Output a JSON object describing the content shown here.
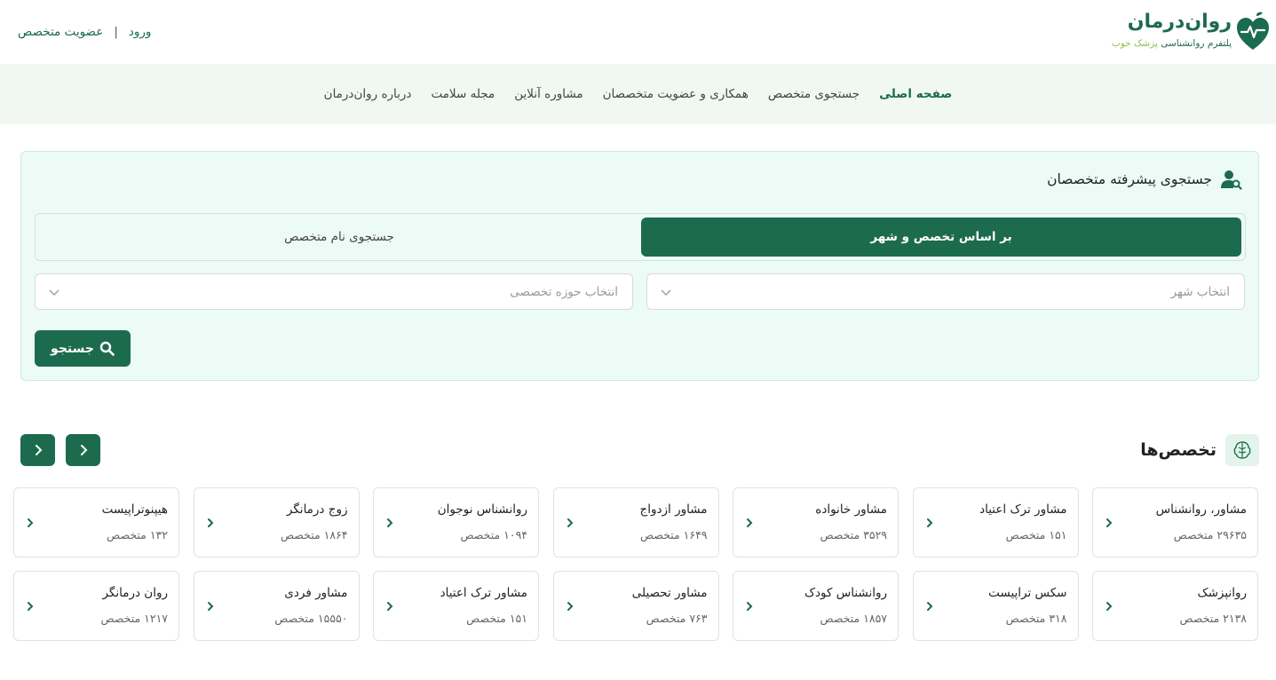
{
  "brand": {
    "title": "روان‌درمان",
    "subtitle_main": "پلتفرم روانشناسی ",
    "subtitle_accent": "پزشک خوب"
  },
  "auth": {
    "membership": "عضویت متخصص",
    "separator": "|",
    "login": "ورود"
  },
  "nav": [
    {
      "label": "صفحه اصلی",
      "active": true
    },
    {
      "label": "جستجوی متخصص",
      "active": false
    },
    {
      "label": "همکاری و عضویت متخصصان",
      "active": false
    },
    {
      "label": "مشاوره آنلاین",
      "active": false
    },
    {
      "label": "مجله سلامت",
      "active": false
    },
    {
      "label": "درباره روان‌درمان",
      "active": false
    }
  ],
  "search": {
    "title": "جستجوی پیشرفته متخصصان",
    "tab_active": "بر اساس تخصص و شهر",
    "tab_inactive": "جستجوی نام متخصص",
    "city_placeholder": "انتخاب شهر",
    "field_placeholder": "انتخاب حوزه تخصصی",
    "button": "جستجو"
  },
  "specialties": {
    "title": "تخصص‌ها",
    "row1": [
      {
        "name": "مشاور، روانشناس",
        "count": "۲۹۶۳۵ متخصص"
      },
      {
        "name": "مشاور ترک اعتیاد",
        "count": "۱۵۱ متخصص"
      },
      {
        "name": "مشاور خانواده",
        "count": "۳۵۲۹ متخصص"
      },
      {
        "name": "مشاور ازدواج",
        "count": "۱۶۴۹ متخصص"
      },
      {
        "name": "روانشناس نوجوان",
        "count": "۱۰۹۴ متخصص"
      },
      {
        "name": "زوج درمانگر",
        "count": "۱۸۶۴ متخصص"
      },
      {
        "name": "هیپنوتراپیست",
        "count": "۱۳۲ متخصص"
      }
    ],
    "row2": [
      {
        "name": "روانپزشک",
        "count": "۲۱۳۸ متخصص"
      },
      {
        "name": "سکس تراپیست",
        "count": "۳۱۸ متخصص"
      },
      {
        "name": "روانشناس کودک",
        "count": "۱۸۵۷ متخصص"
      },
      {
        "name": "مشاور تحصیلی",
        "count": "۷۶۳ متخصص"
      },
      {
        "name": "مشاور ترک اعتیاد",
        "count": "۱۵۱ متخصص"
      },
      {
        "name": "مشاور فردی",
        "count": "۱۵۵۵۰ متخصص"
      },
      {
        "name": "روان درمانگر",
        "count": "۱۲۱۷ متخصص"
      }
    ]
  },
  "colors": {
    "brand_green": "#1d6b4f",
    "accent_green": "#8bc34a",
    "nav_bg": "#f1f8f3",
    "panel_bg": "#ecfbf6"
  }
}
